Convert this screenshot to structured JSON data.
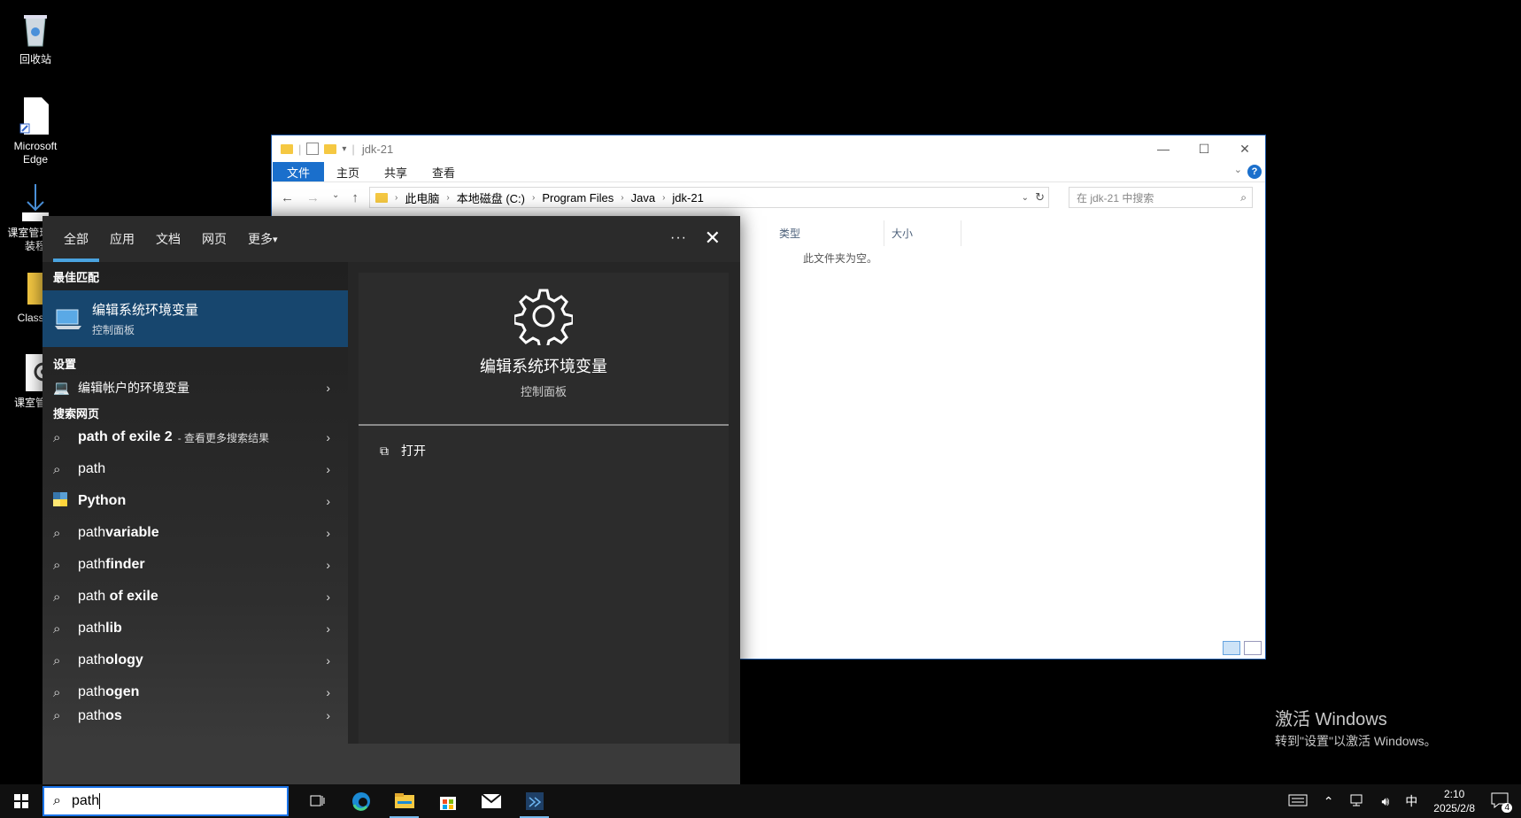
{
  "desktop": {
    "icons": [
      {
        "label": "回收站"
      },
      {
        "label": "Microsoft Edge"
      },
      {
        "label": "课室管理 安装程"
      },
      {
        "label": "Classro"
      },
      {
        "label": "课室管理"
      }
    ]
  },
  "explorer": {
    "title": "jdk-21",
    "ribbon_tabs": [
      "文件",
      "主页",
      "共享",
      "查看"
    ],
    "breadcrumb": [
      "此电脑",
      "本地磁盘 (C:)",
      "Program Files",
      "Java",
      "jdk-21"
    ],
    "search_placeholder": "在 jdk-21 中搜索",
    "columns": [
      "类型",
      "大小"
    ],
    "empty_text": "此文件夹为空。",
    "help": "?"
  },
  "search": {
    "tabs": [
      "全部",
      "应用",
      "文档",
      "网页",
      "更多"
    ],
    "dots": "···",
    "close": "✕",
    "best_match_header": "最佳匹配",
    "best_match": {
      "title": "编辑系统环境变量",
      "subtitle": "控制面板"
    },
    "settings_header": "设置",
    "settings_item": "编辑帐户的环境变量",
    "web_header": "搜索网页",
    "web_items": [
      {
        "pre": "",
        "post": "path of exile 2",
        "suffix": "- 查看更多搜索结果"
      },
      {
        "pre": "path",
        "post": "",
        "suffix": ""
      },
      {
        "pre": "",
        "post": "Python",
        "suffix": ""
      },
      {
        "pre": "path",
        "post": "variable",
        "suffix": ""
      },
      {
        "pre": "path",
        "post": "finder",
        "suffix": ""
      },
      {
        "pre": "path",
        "post": " of exile",
        "suffix": ""
      },
      {
        "pre": "path",
        "post": "lib",
        "suffix": ""
      },
      {
        "pre": "path",
        "post": "ology",
        "suffix": ""
      },
      {
        "pre": "path",
        "post": "ogen",
        "suffix": ""
      },
      {
        "pre": "path",
        "post": "os",
        "suffix": ""
      }
    ],
    "preview": {
      "title": "编辑系统环境变量",
      "subtitle": "控制面板",
      "open_label": "打开"
    }
  },
  "taskbar": {
    "search_value": "path",
    "ime": "中",
    "time": "2:10",
    "date": "2025/2/8",
    "notifications": "4"
  },
  "watermark": {
    "line1": "激活 Windows",
    "line2": "转到\"设置\"以激活 Windows。"
  }
}
